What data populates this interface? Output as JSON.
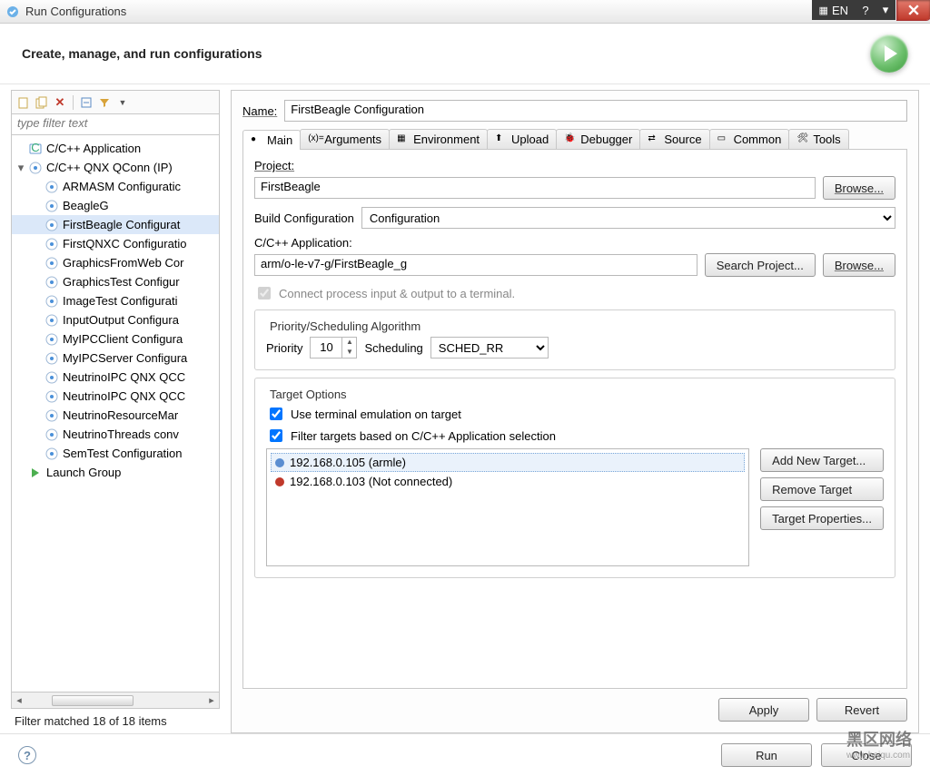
{
  "window": {
    "title": "Run Configurations"
  },
  "header": {
    "title": "Create, manage, and run configurations"
  },
  "left": {
    "filter_placeholder": "type filter text",
    "tree": [
      {
        "label": "C/C++ Application",
        "icon": "c-app"
      },
      {
        "label": "C/C++ QNX QConn (IP)",
        "icon": "c-qnx",
        "children": [
          {
            "label": "ARMASM Configuratic"
          },
          {
            "label": "BeagleG"
          },
          {
            "label": "FirstBeagle Configurat",
            "selected": true
          },
          {
            "label": "FirstQNXC Configuratio"
          },
          {
            "label": "GraphicsFromWeb Cor"
          },
          {
            "label": "GraphicsTest Configur"
          },
          {
            "label": "ImageTest Configurati"
          },
          {
            "label": "InputOutput Configura"
          },
          {
            "label": "MyIPCClient Configura"
          },
          {
            "label": "MyIPCServer Configura"
          },
          {
            "label": "NeutrinoIPC QNX QCC"
          },
          {
            "label": "NeutrinoIPC QNX QCC"
          },
          {
            "label": "NeutrinoResourceMar"
          },
          {
            "label": "NeutrinoThreads conv"
          },
          {
            "label": "SemTest Configuration"
          }
        ]
      },
      {
        "label": "Launch Group",
        "icon": "launch-group"
      }
    ],
    "filter_status": "Filter matched 18 of 18 items"
  },
  "right": {
    "name_label": "Name:",
    "name_value": "FirstBeagle Configuration",
    "tabs": [
      "Main",
      "Arguments",
      "Environment",
      "Upload",
      "Debugger",
      "Source",
      "Common",
      "Tools"
    ],
    "active_tab": "Main",
    "project_label": "Project:",
    "project_value": "FirstBeagle",
    "browse_label": "Browse...",
    "build_cfg_label": "Build Configuration",
    "build_cfg_value": "Configuration",
    "app_label": "C/C++ Application:",
    "app_value": "arm/o-le-v7-g/FirstBeagle_g",
    "search_project_label": "Search Project...",
    "connect_terminal_label": "Connect process input & output to a terminal.",
    "priority_group_title": "Priority/Scheduling Algorithm",
    "priority_label": "Priority",
    "priority_value": "10",
    "scheduling_label": "Scheduling",
    "scheduling_value": "SCHED_RR",
    "target_group_title": "Target Options",
    "use_terminal_label": "Use terminal emulation on target",
    "filter_targets_label": "Filter targets based on C/C++ Application selection",
    "targets": [
      {
        "label": "192.168.0.105 (armle)",
        "selected": true,
        "connected": true
      },
      {
        "label": "192.168.0.103 (Not connected)",
        "selected": false,
        "connected": false
      }
    ],
    "add_target_label": "Add New Target...",
    "remove_target_label": "Remove Target",
    "target_props_label": "Target Properties...",
    "apply_label": "Apply",
    "revert_label": "Revert"
  },
  "footer": {
    "run_label": "Run",
    "close_label": "Close"
  },
  "sys": {
    "lang": "EN"
  }
}
